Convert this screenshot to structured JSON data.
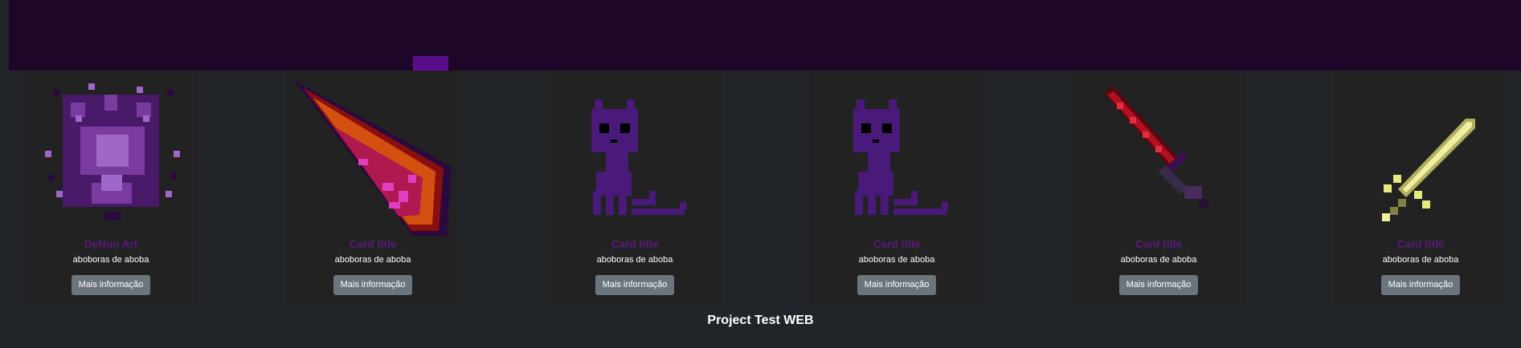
{
  "header": {
    "accent_color": "#1e0629",
    "tab_color": "#5a0e8c"
  },
  "cards": [
    {
      "title": "DeNun Art",
      "text": "aboboras de aboba",
      "button": "Mais informação",
      "image": "purple-flower-pixel-art",
      "title_color": "#5a1a7a"
    },
    {
      "title": "Card title",
      "text": "aboboras de aboba",
      "button": "Mais informação",
      "image": "crystal-shard-pixel-art",
      "title_color": "#5a1a7a"
    },
    {
      "title": "Card title",
      "text": "aboboras de aboba",
      "button": "Mais informação",
      "image": "purple-creature-pixel-art",
      "title_color": "#5a1a7a"
    },
    {
      "title": "Card title",
      "text": "aboboras de aboba",
      "button": "Mais informação",
      "image": "purple-creature-pixel-art",
      "title_color": "#5a1a7a"
    },
    {
      "title": "Card title",
      "text": "aboboras de aboba",
      "button": "Mais informação",
      "image": "red-sword-pixel-art",
      "title_color": "#5a1a7a"
    },
    {
      "title": "Card title",
      "text": "aboboras de aboba",
      "button": "Mais informação",
      "image": "gold-sword-pixel-art",
      "title_color": "#5a1a7a"
    }
  ],
  "footer": {
    "text": "Project Test WEB"
  }
}
